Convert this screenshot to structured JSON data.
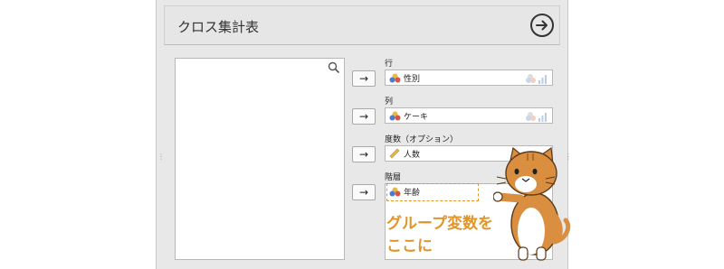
{
  "header": {
    "title": "クロス集計表"
  },
  "slots": [
    {
      "label": "行",
      "value": "性別",
      "icon": "nominal-icon",
      "type_icon": "nominal-type-icon",
      "move": "→"
    },
    {
      "label": "列",
      "value": "ケーキ",
      "icon": "nominal-icon",
      "type_icon": "nominal-type-icon",
      "move": "→"
    },
    {
      "label": "度数（オプション）",
      "value": "人数",
      "icon": "ruler-icon",
      "type_icon": "scale-type-icon",
      "move": "→"
    },
    {
      "label": "階層",
      "value": "年齢",
      "icon": "nominal-icon",
      "type_icon": "",
      "move": "→"
    }
  ],
  "callout": {
    "line1": "グループ変数を",
    "line2": "ここに"
  },
  "colors": {
    "accent": "#e0952a",
    "panel": "#e8e8e8",
    "cat_fur": "#d98f3f"
  },
  "icons": [
    "go-arrow-icon",
    "search-icon",
    "nominal-icon",
    "ruler-icon",
    "cat-mascot"
  ]
}
